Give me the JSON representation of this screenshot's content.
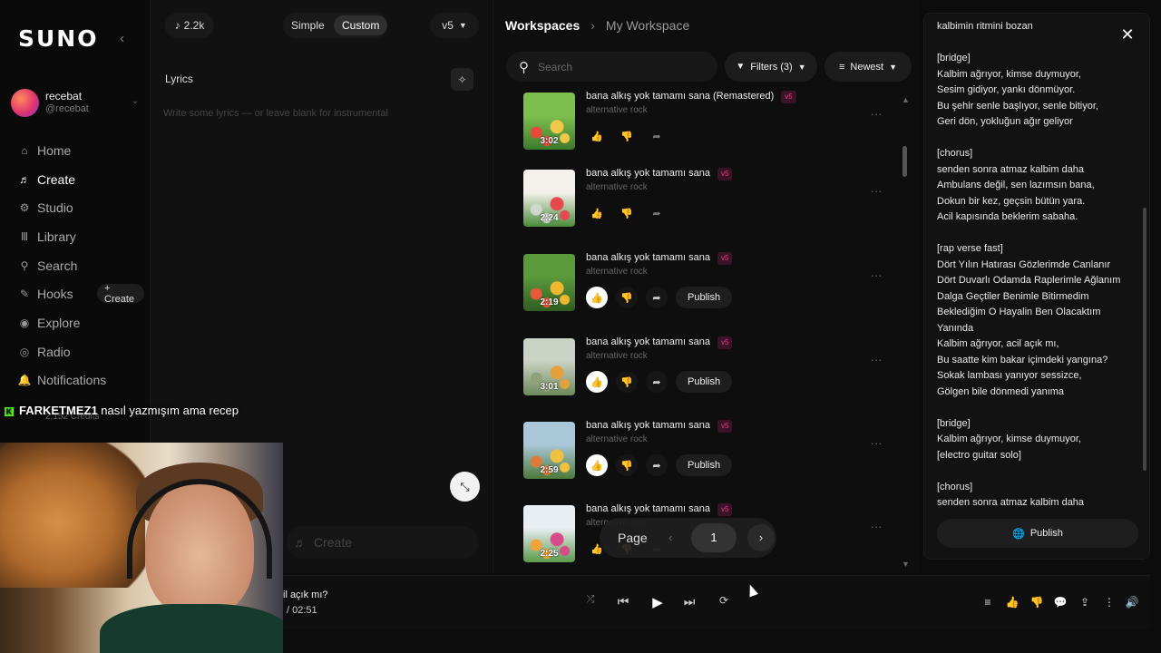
{
  "sidebar": {
    "logo": "SUNO",
    "collapse_icon": "‹",
    "user": {
      "name": "recebat",
      "handle": "@recebat"
    },
    "nav": [
      {
        "label": "Home",
        "icon": "⌂",
        "name": "home"
      },
      {
        "label": "Create",
        "icon": "♬",
        "name": "create"
      },
      {
        "label": "Studio",
        "icon": "⚙",
        "name": "studio"
      },
      {
        "label": "Library",
        "icon": "Ⅲ",
        "name": "library"
      },
      {
        "label": "Search",
        "icon": "⚲",
        "name": "search"
      },
      {
        "label": "Hooks",
        "icon": "✎",
        "name": "hooks"
      },
      {
        "label": "Explore",
        "icon": "◉",
        "name": "explore"
      },
      {
        "label": "Radio",
        "icon": "◎",
        "name": "radio"
      },
      {
        "label": "Notifications",
        "icon": "🔔",
        "name": "notifications"
      }
    ],
    "hooks_create": "+ Create",
    "credits": "2,152 Credits"
  },
  "chat": {
    "user": "FARKETMEZ1",
    "message": "nasıl yazmışım ama recep"
  },
  "create": {
    "count": "2.2k",
    "mode_simple": "Simple",
    "mode_custom": "Custom",
    "model": "v5",
    "lyrics_label": "Lyrics",
    "lyrics_placeholder": "Write some lyrics — or leave blank for instrumental",
    "create_button": "Create"
  },
  "workspace": {
    "breadcrumb_root": "Workspaces",
    "breadcrumb_current": "My Workspace",
    "search_placeholder": "Search",
    "filters": "Filters (3)",
    "sort": "Newest",
    "publish_label": "Publish",
    "songs": [
      {
        "title": "bana alkış yok tamamı sana (Remastered)",
        "tag": "v5",
        "genre": "alternative rock",
        "duration": "3:02",
        "publish": false,
        "liked": false,
        "palette": [
          "#7dbf4e",
          "#e84a3a",
          "#f2c84b",
          "#3d7a2c"
        ]
      },
      {
        "title": "bana alkış yok tamamı sana",
        "tag": "v5",
        "genre": "alternative rock",
        "duration": "2:24",
        "publish": false,
        "liked": false,
        "palette": [
          "#f4f1ec",
          "#cfd8cc",
          "#e5484d",
          "#4b8a3a"
        ]
      },
      {
        "title": "bana alkış yok tamamı sana",
        "tag": "v5",
        "genre": "alternative rock",
        "duration": "2:19",
        "publish": true,
        "liked": true,
        "palette": [
          "#5a9a3a",
          "#e8583a",
          "#f0b830",
          "#2f5e22"
        ]
      },
      {
        "title": "bana alkış yok tamamı sana",
        "tag": "v5",
        "genre": "alternative rock",
        "duration": "3:01",
        "publish": true,
        "liked": true,
        "palette": [
          "#c9d2c4",
          "#8fa07a",
          "#e3a13b",
          "#6d8a5a"
        ]
      },
      {
        "title": "bana alkış yok tamamı sana",
        "tag": "v5",
        "genre": "alternative rock",
        "duration": "2:59",
        "publish": true,
        "liked": true,
        "palette": [
          "#a9c7d8",
          "#e07a3a",
          "#f0c040",
          "#4a7a3a"
        ]
      },
      {
        "title": "bana alkış yok tamamı sana",
        "tag": "v5",
        "genre": "alternative rock",
        "duration": "2:25",
        "publish": false,
        "liked": false,
        "palette": [
          "#e8eef2",
          "#f2a23a",
          "#d94a8a",
          "#5a9a4a"
        ]
      }
    ],
    "pager": {
      "label": "Page",
      "current": "1",
      "prev": "‹",
      "next": "›"
    }
  },
  "detail": {
    "lyrics": "kalbimin ritmini bozan\n\n[bridge]\nKalbim ağrıyor, kimse duymuyor,\nSesim gidiyor, yankı dönmüyor.\nBu şehir senle başlıyor, senle bitiyor,\nGeri dön, yokluğun ağır geliyor\n\n[chorus]\nsenden sonra atmaz kalbim daha\nAmbulans değil, sen lazımsın bana,\nDokun bir kez, geçsin bütün yara.\nAcil kapısında beklerim sabaha.\n\n[rap verse fast]\nDört Yılın Hatırası Gözlerimde Canlanır\nDört Duvarlı Odamda Raplerimle Ağlanım\nDalga Geçtiler Benimle Bitirmedim\nBeklediğim O Hayalin Ben Olacaktım\nYanında\nKalbim ağrıyor, acil açık mı,\nBu saatte kim bakar içimdeki yangına?\nSokak lambası yanıyor sessizce,\nGölgen bile dönmedi yanıma\n\n[bridge]\nKalbim ağrıyor, kimse duymuyor,\n[electro guitar solo]\n\n[chorus]\nsenden sonra atmaz kalbim daha",
    "publish": "Publish",
    "close": "✕"
  },
  "player": {
    "title": "il açık mı?",
    "time": "/  02:51"
  }
}
